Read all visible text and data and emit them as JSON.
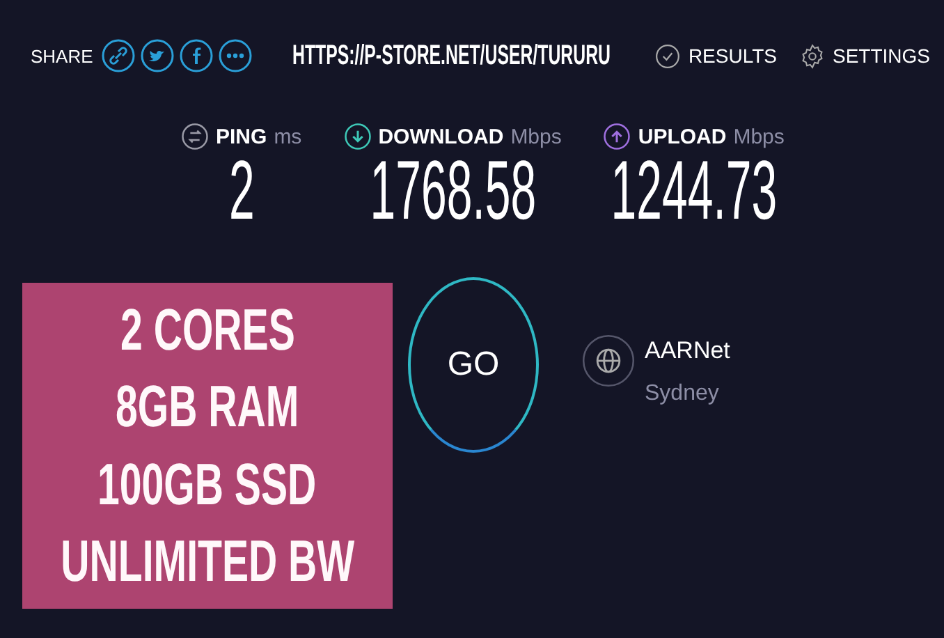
{
  "header": {
    "share_label": "SHARE",
    "url": "HTTPS://P-STORE.NET/USER/TURURU",
    "links": [
      {
        "kind": "results",
        "label": "RESULTS"
      },
      {
        "kind": "settings",
        "label": "SETTINGS"
      }
    ]
  },
  "metrics": [
    {
      "kind": "ping",
      "label": "PING",
      "unit": "ms",
      "value": "2"
    },
    {
      "kind": "download",
      "label": "DOWNLOAD",
      "unit": "Mbps",
      "value": "1768.58"
    },
    {
      "kind": "upload",
      "label": "UPLOAD",
      "unit": "Mbps",
      "value": "1244.73"
    }
  ],
  "promo": {
    "lines": [
      "2 CORES",
      "8GB RAM",
      "100GB SSD",
      "UNLIMITED BW"
    ]
  },
  "go_button": {
    "label": "GO"
  },
  "server": {
    "name": "AARNet",
    "location": "Sydney"
  }
}
